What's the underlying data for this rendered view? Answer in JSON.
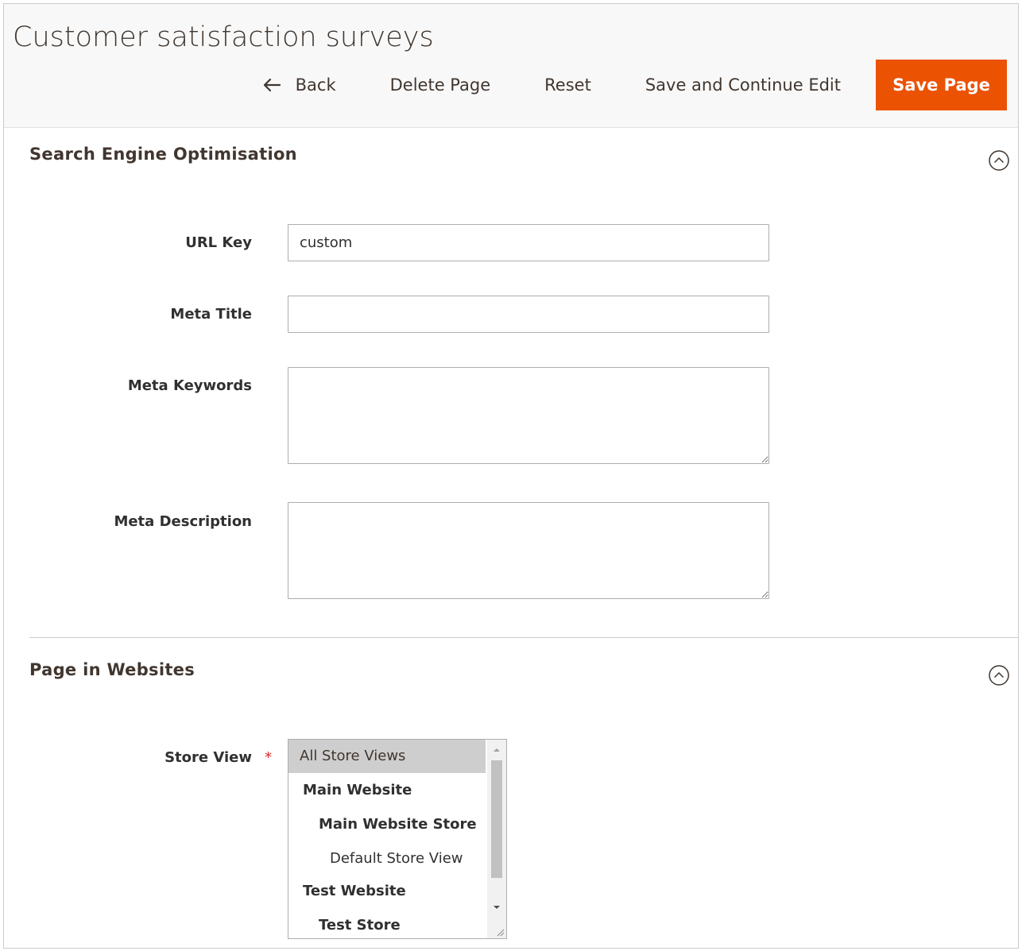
{
  "header": {
    "title": "Customer satisfaction surveys",
    "actions": {
      "back": "Back",
      "delete": "Delete Page",
      "reset": "Reset",
      "save_continue": "Save and Continue Edit",
      "save": "Save Page"
    }
  },
  "seo": {
    "title": "Search Engine Optimisation",
    "url_key": {
      "label": "URL Key",
      "value": "custom"
    },
    "meta_title": {
      "label": "Meta Title",
      "value": ""
    },
    "meta_keywords": {
      "label": "Meta Keywords",
      "value": ""
    },
    "meta_description": {
      "label": "Meta Description",
      "value": ""
    }
  },
  "websites": {
    "title": "Page in Websites",
    "store_view": {
      "label": "Store View",
      "required_mark": "*",
      "options": [
        {
          "label": "All Store Views",
          "selected": true,
          "bold": false,
          "level": 0
        },
        {
          "label": "Main Website",
          "selected": false,
          "bold": true,
          "level": 1
        },
        {
          "label": "Main Website Store",
          "selected": false,
          "bold": true,
          "level": 2
        },
        {
          "label": "Default Store View",
          "selected": false,
          "bold": false,
          "level": 3
        },
        {
          "label": "Test Website",
          "selected": false,
          "bold": true,
          "level": 1
        },
        {
          "label": "Test Store",
          "selected": false,
          "bold": true,
          "level": 2
        }
      ]
    }
  },
  "colors": {
    "primary_button": "#eb5202",
    "required": "#e22626",
    "selected_option": "#cecece"
  },
  "icons": {
    "back": "arrow-left-icon",
    "collapse": "chevron-up-circle-icon"
  }
}
